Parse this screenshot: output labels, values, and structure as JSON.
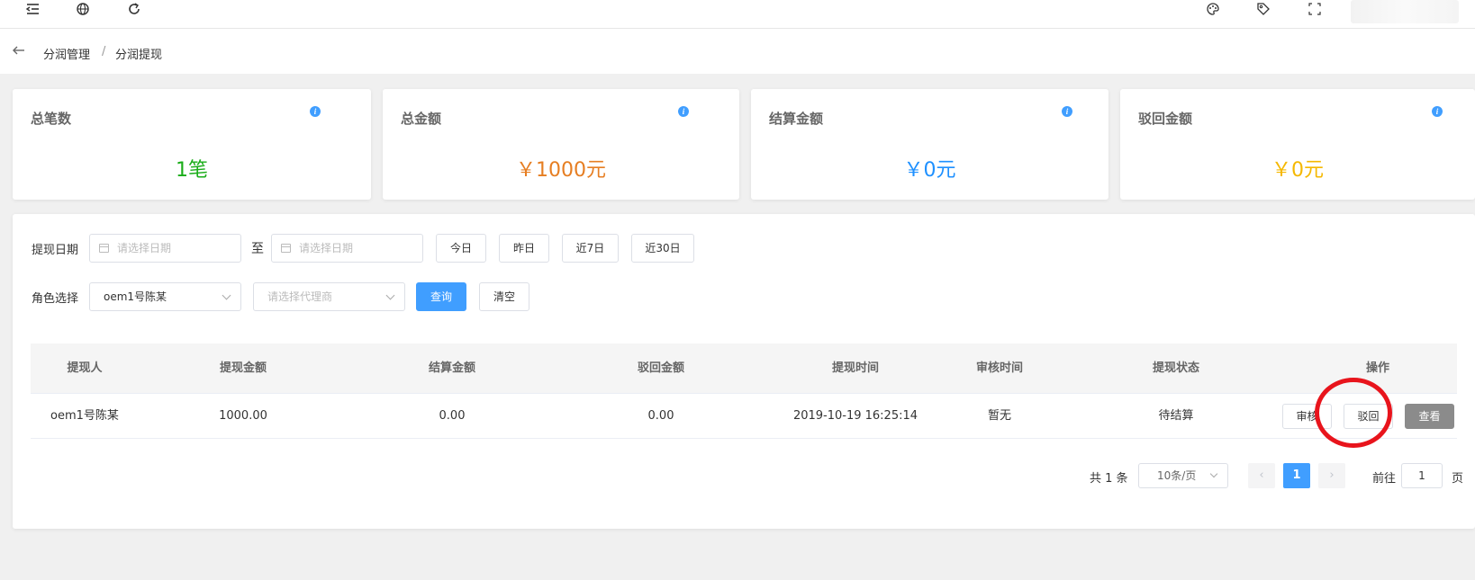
{
  "breadcrumb": {
    "level1": "分润管理",
    "separator": "/",
    "level2": "分润提现"
  },
  "stats": [
    {
      "title": "总笔数",
      "value": "1笔",
      "color": "#1aad19"
    },
    {
      "title": "总金额",
      "value": "￥1000元",
      "color": "#e67e22"
    },
    {
      "title": "结算金额",
      "value": "￥0元",
      "color": "#1e90ff"
    },
    {
      "title": "驳回金额",
      "value": "￥0元",
      "color": "#f5b800"
    }
  ],
  "filters": {
    "date_label": "提现日期",
    "start_placeholder": "请选择日期",
    "to_label": "至",
    "end_placeholder": "请选择日期",
    "quick": [
      "今日",
      "昨日",
      "近7日",
      "近30日"
    ],
    "role_label": "角色选择",
    "role_value": "oem1号陈某",
    "agent_placeholder": "请选择代理商",
    "query_label": "查询",
    "clear_label": "清空"
  },
  "table": {
    "columns": [
      "提现人",
      "提现金额",
      "结算金额",
      "驳回金额",
      "提现时间",
      "审核时间",
      "提现状态",
      "操作"
    ],
    "rows": [
      {
        "user": "oem1号陈某",
        "amount": "1000.00",
        "settled": "0.00",
        "rejected": "0.00",
        "time": "2019-10-19 16:25:14",
        "review_time": "暂无",
        "status": "待结算",
        "actions": {
          "review": "审核",
          "reject": "驳回",
          "view": "查看"
        }
      }
    ]
  },
  "pagination": {
    "total": "共 1 条",
    "page_size": "10条/页",
    "prev": "‹",
    "current": "1",
    "next": "›",
    "goto_label": "前往",
    "goto_value": "1",
    "page_suffix": "页"
  }
}
